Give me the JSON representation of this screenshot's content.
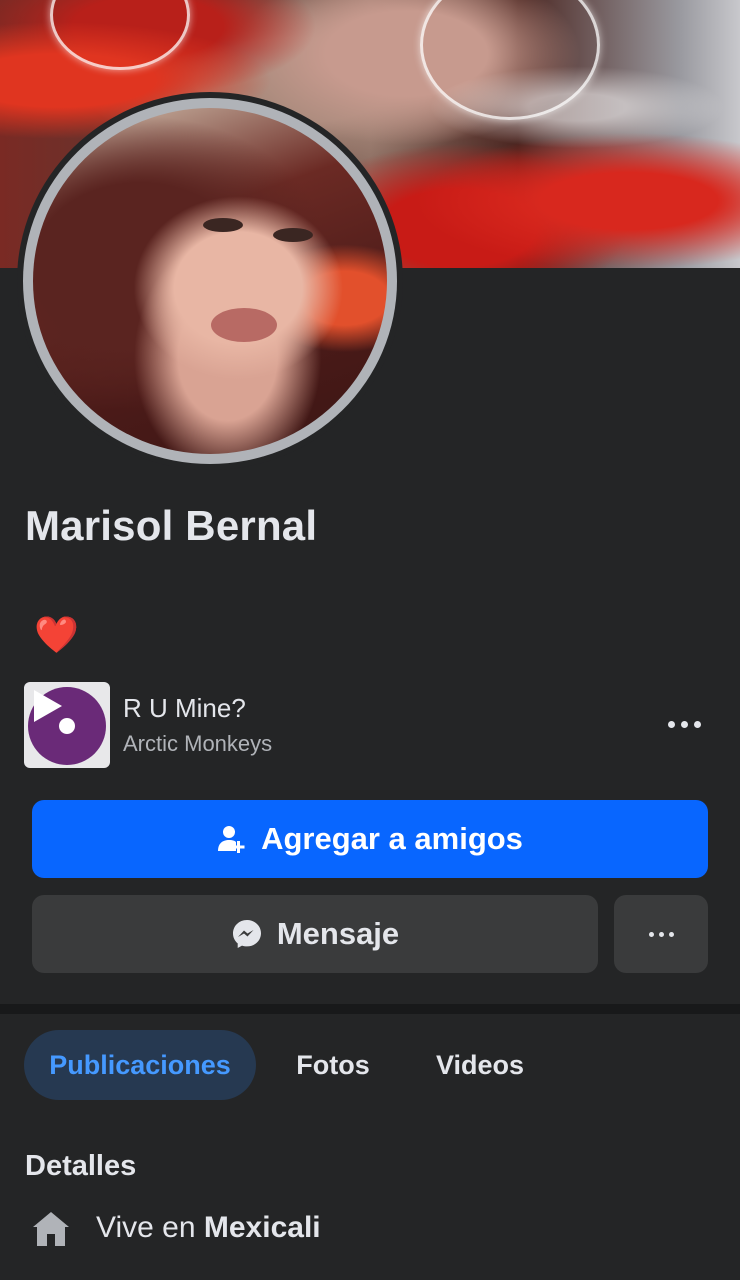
{
  "profile": {
    "name": "Marisol Bernal",
    "bio_emoji": "❤️"
  },
  "music": {
    "song_title": "R U Mine?",
    "artist": "Arctic Monkeys"
  },
  "actions": {
    "add_friend_label": "Agregar a amigos",
    "message_label": "Mensaje"
  },
  "tabs": [
    {
      "label": "Publicaciones",
      "active": true
    },
    {
      "label": "Fotos",
      "active": false
    },
    {
      "label": "Videos",
      "active": false
    }
  ],
  "details": {
    "title": "Detalles",
    "lives_prefix": "Vive en",
    "lives_city": "Mexicali"
  },
  "colors": {
    "background": "#242526",
    "primary_button": "#0866ff",
    "secondary_button": "#3a3b3c",
    "active_tab_bg": "#263951",
    "active_tab_text": "#4599ff"
  },
  "icons": {
    "add_friend": "person-plus-icon",
    "message": "messenger-icon",
    "more": "ellipsis-icon",
    "home": "home-icon",
    "play": "play-icon"
  }
}
